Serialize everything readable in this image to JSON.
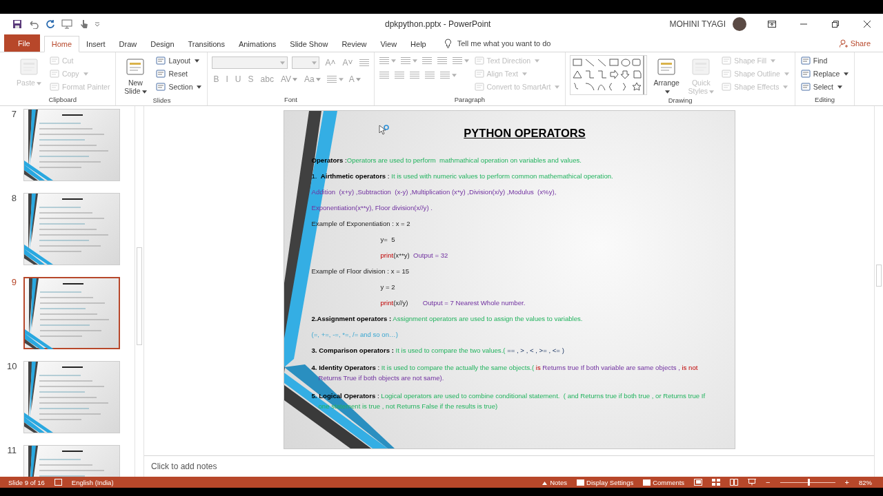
{
  "title_bar": {
    "title": "dpkpython.pptx  -  PowerPoint",
    "user": "MOHINI TYAGI"
  },
  "tabs": [
    {
      "label": "File",
      "kind": "file",
      "selected": false
    },
    {
      "label": "Home",
      "kind": "tab",
      "selected": true
    },
    {
      "label": "Insert",
      "kind": "tab",
      "selected": false
    },
    {
      "label": "Draw",
      "kind": "tab",
      "selected": false
    },
    {
      "label": "Design",
      "kind": "tab",
      "selected": false
    },
    {
      "label": "Transitions",
      "kind": "tab",
      "selected": false
    },
    {
      "label": "Animations",
      "kind": "tab",
      "selected": false
    },
    {
      "label": "Slide Show",
      "kind": "tab",
      "selected": false
    },
    {
      "label": "Review",
      "kind": "tab",
      "selected": false
    },
    {
      "label": "View",
      "kind": "tab",
      "selected": false
    },
    {
      "label": "Help",
      "kind": "tab",
      "selected": false
    }
  ],
  "tell_me": {
    "placeholder": "Tell me what you want to do"
  },
  "share": "Share",
  "ribbon": [
    {
      "label": "Clipboard",
      "items": [
        {
          "kind": "large",
          "label": "Paste",
          "disabled": true,
          "dropdown": true
        },
        {
          "kind": "small",
          "label": "Cut",
          "disabled": true,
          "dropdown": false
        },
        {
          "kind": "small",
          "label": "Copy",
          "disabled": true,
          "dropdown": true
        },
        {
          "kind": "small",
          "label": "Format Painter",
          "disabled": true,
          "dropdown": false
        }
      ]
    },
    {
      "label": "Slides",
      "items": [
        {
          "kind": "large",
          "label": "New Slide",
          "disabled": false,
          "dropdown": true
        },
        {
          "kind": "small",
          "label": "Layout",
          "disabled": false,
          "dropdown": true
        },
        {
          "kind": "small",
          "label": "Reset",
          "disabled": false,
          "dropdown": false
        },
        {
          "kind": "small",
          "label": "Section",
          "disabled": false,
          "dropdown": true
        }
      ]
    },
    {
      "label": "Font",
      "tool_rows": [
        [
          {
            "kind": "field",
            "disabled": true,
            "dropdown": true
          },
          {
            "kind": "field",
            "disabled": true,
            "dropdown": true
          },
          {
            "kind": "glyph",
            "label": "A˄",
            "disabled": true,
            "dropdown": false
          },
          {
            "kind": "glyph",
            "label": "A˅",
            "disabled": true,
            "dropdown": false
          },
          {
            "kind": "icon",
            "disabled": true,
            "dropdown": false
          }
        ],
        [
          {
            "kind": "glyph",
            "label": "B",
            "disabled": true,
            "dropdown": false
          },
          {
            "kind": "glyph",
            "label": "I",
            "disabled": true,
            "dropdown": false
          },
          {
            "kind": "glyph",
            "label": "U",
            "disabled": true,
            "dropdown": false
          },
          {
            "kind": "glyph",
            "label": "S",
            "disabled": true,
            "dropdown": false
          },
          {
            "kind": "glyph",
            "label": "abc",
            "disabled": true,
            "dropdown": false
          },
          {
            "kind": "glyph",
            "label": "AV",
            "disabled": true,
            "dropdown": true
          },
          {
            "kind": "glyph",
            "label": "Aa",
            "disabled": true,
            "dropdown": true
          },
          {
            "kind": "icon",
            "disabled": true,
            "dropdown": true
          },
          {
            "kind": "glyph",
            "label": "A",
            "disabled": true,
            "dropdown": true
          }
        ]
      ]
    },
    {
      "label": "Paragraph",
      "tool_rows": [
        [
          {
            "kind": "icon",
            "disabled": true,
            "dropdown": true
          },
          {
            "kind": "icon",
            "disabled": true,
            "dropdown": true
          },
          {
            "kind": "icon",
            "disabled": true,
            "dropdown": false
          },
          {
            "kind": "icon",
            "disabled": true,
            "dropdown": false
          },
          {
            "kind": "icon",
            "disabled": true,
            "dropdown": true
          }
        ],
        [
          {
            "kind": "icon",
            "disabled": true,
            "dropdown": false
          },
          {
            "kind": "icon",
            "disabled": true,
            "dropdown": false
          },
          {
            "kind": "icon",
            "disabled": true,
            "dropdown": false
          },
          {
            "kind": "icon",
            "disabled": true,
            "dropdown": false
          },
          {
            "kind": "icon",
            "disabled": true,
            "dropdown": true
          }
        ]
      ],
      "items": [
        {
          "kind": "small",
          "label": "Text Direction",
          "disabled": true,
          "dropdown": true
        },
        {
          "kind": "small",
          "label": "Align Text",
          "disabled": true,
          "dropdown": true
        },
        {
          "kind": "small",
          "label": "Convert to SmartArt",
          "disabled": true,
          "dropdown": true
        }
      ]
    },
    {
      "label": "Drawing",
      "items": [
        {
          "kind": "gallery"
        },
        {
          "kind": "large",
          "label": "Arrange",
          "disabled": false,
          "dropdown": true
        },
        {
          "kind": "large",
          "label": "Quick Styles",
          "disabled": true,
          "dropdown": true
        },
        {
          "kind": "small",
          "label": "Shape Fill",
          "disabled": true,
          "dropdown": true
        },
        {
          "kind": "small",
          "label": "Shape Outline",
          "disabled": true,
          "dropdown": true
        },
        {
          "kind": "small",
          "label": "Shape Effects",
          "disabled": true,
          "dropdown": true
        }
      ]
    },
    {
      "label": "Editing",
      "items": [
        {
          "kind": "small",
          "label": "Find",
          "disabled": false,
          "dropdown": false
        },
        {
          "kind": "small",
          "label": "Replace",
          "disabled": false,
          "dropdown": true
        },
        {
          "kind": "small",
          "label": "Select",
          "disabled": false,
          "dropdown": true
        }
      ]
    }
  ],
  "thumbnails": [
    {
      "number": "7",
      "selected": false
    },
    {
      "number": "8",
      "selected": false
    },
    {
      "number": "9",
      "selected": true
    },
    {
      "number": "10",
      "selected": false
    },
    {
      "number": "11",
      "selected": false
    }
  ],
  "slide": {
    "title": "PYTHON OPERATORS",
    "lines": [
      {
        "kind": "plain",
        "segments": [
          {
            "text": "**Operators** :",
            "kind": "label"
          },
          {
            "text": "Operators are used to perform  mathmathical operation on variables and values.",
            "kind": "description"
          }
        ]
      },
      {
        "kind": "plain",
        "segments": [
          {
            "text": "1.  **Airthmetic operators** :",
            "kind": "label"
          },
          {
            "text": " It is used with numeric values to perform common mathemathical operation.",
            "kind": "description"
          }
        ]
      },
      {
        "kind": "plain",
        "segments": [
          {
            "text": "Addition  (x+y) ,Subtraction  (x-y) ,Multiplication (x*y) ,Division(x/y) ,Modulus  (x%y),",
            "kind": "example"
          }
        ]
      },
      {
        "kind": "plain",
        "segments": [
          {
            "text": "Exponentiation(x**y), Floor division(x//y) .",
            "kind": "example"
          }
        ]
      },
      {
        "kind": "plain",
        "segments": [
          {
            "text": "Example of Exponentiation : x = 2",
            "kind": "plain"
          }
        ]
      },
      {
        "kind": "indented",
        "segments": [
          {
            "text": "y=  5",
            "kind": "plain"
          }
        ]
      },
      {
        "kind": "indented",
        "segments": [
          {
            "text": "print",
            "kind": "keyword"
          },
          {
            "text": "(x**y)  ",
            "kind": "plain"
          },
          {
            "text": "Output = 32",
            "kind": "example"
          }
        ]
      },
      {
        "kind": "plain",
        "segments": [
          {
            "text": "Example of Floor division : x = 15",
            "kind": "plain"
          }
        ]
      },
      {
        "kind": "indented",
        "segments": [
          {
            "text": "y = 2",
            "kind": "plain"
          }
        ]
      },
      {
        "kind": "indented",
        "segments": [
          {
            "text": "print",
            "kind": "keyword"
          },
          {
            "text": "(x//y)        ",
            "kind": "plain"
          },
          {
            "text": "Output = 7 Nearest Whole number.",
            "kind": "example"
          }
        ]
      },
      {
        "kind": "plain",
        "segments": [
          {
            "text": "**2.Assignment operators :**",
            "kind": "label"
          },
          {
            "text": " Assignment operators are used to assign the values to variables.",
            "kind": "description"
          }
        ]
      },
      {
        "kind": "plain",
        "segments": [
          {
            "text": "(=, +=, -=, *=, /= and so on…)",
            "kind": "symbols"
          }
        ]
      },
      {
        "kind": "plain",
        "segments": [
          {
            "text": "**3. Comparison operators :**",
            "kind": "label"
          },
          {
            "text": " It is used to compare the two values.(",
            "kind": "description"
          },
          {
            "text": " == , > , < , >= , <= )",
            "kind": "operators"
          }
        ]
      },
      {
        "kind": "hanging",
        "segments": [
          {
            "text": "**4. Identity Operators** :",
            "kind": "label"
          },
          {
            "text": " It is used to compare the actually the same objects.(",
            "kind": "description"
          },
          {
            "text": " is",
            "kind": "keyword"
          },
          {
            "text": " Returns true If both variable are same objects , ",
            "kind": "example"
          },
          {
            "text": "is not",
            "kind": "keyword"
          },
          {
            "text": " Returns True if both objects are not same).",
            "kind": "example"
          }
        ]
      },
      {
        "kind": "hanging",
        "segments": [
          {
            "text": "**5. Logical Operators** :",
            "kind": "label"
          },
          {
            "text": " Logical operators are used to combine conditional statement.  ( and Returns true if both true , or Returns true If one statement is true , not Returns False if the results is true)",
            "kind": "description"
          }
        ]
      }
    ]
  },
  "notes": {
    "placeholder": "Click to add notes"
  },
  "status_bar": {
    "slide": "Slide 9 of 16",
    "language": "English (India)",
    "notes": "Notes",
    "display": "Display Settings",
    "comments": "Comments",
    "zoom_out": "−",
    "zoom_in": "+",
    "zoom": "82%",
    "zoom_slider": {
      "level": 0.5
    }
  }
}
